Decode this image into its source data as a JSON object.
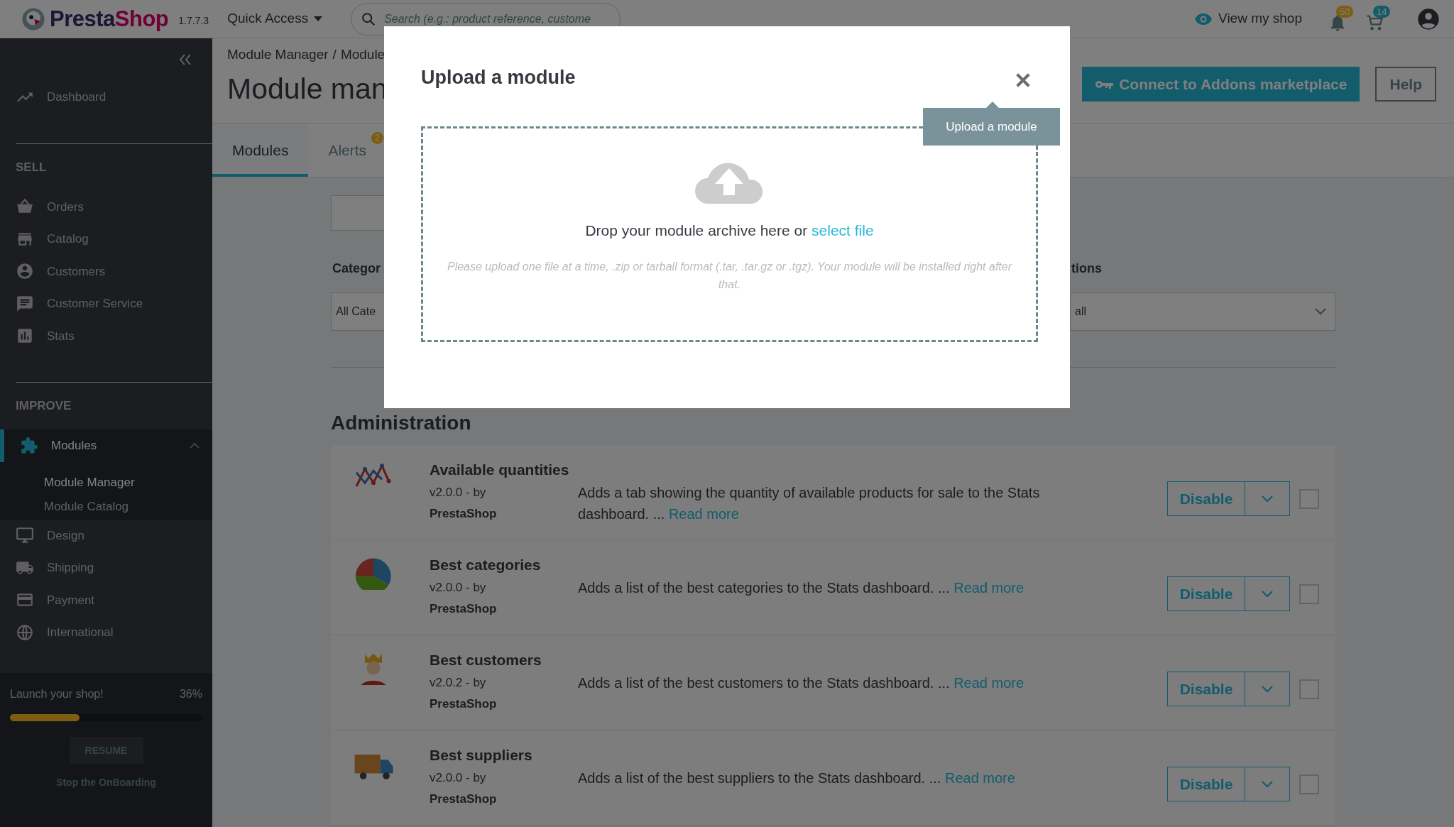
{
  "topbar": {
    "logo": {
      "first": "Presta",
      "second": "Shop"
    },
    "version": "1.7.7.3",
    "quick_access": "Quick Access",
    "search": {
      "placeholder": "Search (e.g.: product reference, custome"
    },
    "view_shop": "View my shop",
    "notifications_count": "50",
    "orders_count": "14"
  },
  "sidebar": {
    "top_items": [
      {
        "label": "Dashboard",
        "kind": "trend",
        "selected": false
      }
    ],
    "sections": [
      {
        "title": "SELL",
        "items": [
          {
            "label": "Orders",
            "kind": "basket",
            "selected": false
          },
          {
            "label": "Catalog",
            "kind": "store",
            "selected": false
          },
          {
            "label": "Customers",
            "kind": "person",
            "selected": false
          },
          {
            "label": "Customer Service",
            "kind": "chat",
            "selected": false
          },
          {
            "label": "Stats",
            "kind": "stats",
            "selected": false
          }
        ]
      },
      {
        "title": "IMPROVE",
        "items": [
          {
            "label": "Modules",
            "kind": "puzzle",
            "selected": true,
            "expanded": true,
            "children": [
              {
                "label": "Module Manager",
                "selected": true
              },
              {
                "label": "Module Catalog",
                "selected": false
              }
            ]
          },
          {
            "label": "Design",
            "kind": "monitor",
            "selected": false
          },
          {
            "label": "Shipping",
            "kind": "truck",
            "selected": false
          },
          {
            "label": "Payment",
            "kind": "card",
            "selected": false
          },
          {
            "label": "International",
            "kind": "globe",
            "selected": false
          }
        ]
      }
    ],
    "onboarding": {
      "title": "Launch your shop!",
      "percent": "36%",
      "level": 0.36,
      "button": "RESUME",
      "link": "Stop the OnBoarding"
    }
  },
  "header": {
    "breadcrumb": [
      "Module Manager",
      "Module"
    ],
    "breadcrumb_separator": "/",
    "title": "Module man",
    "buttons": [
      {
        "label": "Connect to Addons marketplace",
        "kind": "primary"
      },
      {
        "label": "Help",
        "kind": "outline"
      }
    ]
  },
  "tabs": [
    {
      "label": "Modules",
      "selected": true
    },
    {
      "label": "Alerts",
      "selected": false,
      "badge": "2"
    }
  ],
  "filters": {
    "category": {
      "label": "Categor",
      "value": "All Cate"
    },
    "status": {
      "label": "tions",
      "value": "all"
    }
  },
  "section_title": "Administration",
  "modules": [
    {
      "kind": "chart",
      "name": "Available quantities",
      "version": "v2.0.0 - by",
      "author": "PrestaShop",
      "description": "Adds a tab showing the quantity of available products for sale to the Stats dashboard. ...",
      "link": "Read more",
      "action": "Disable",
      "checked": false
    },
    {
      "kind": "pie",
      "name": "Best categories",
      "version": "v2.0.0 - by",
      "author": "PrestaShop",
      "description": "Adds a list of the best categories to the Stats dashboard. ...",
      "link": "Read more",
      "action": "Disable",
      "checked": false
    },
    {
      "kind": "person",
      "name": "Best customers",
      "version": "v2.0.2 - by",
      "author": "PrestaShop",
      "description": "Adds a list of the best customers to the Stats dashboard. ...",
      "link": "Read more",
      "action": "Disable",
      "checked": false
    },
    {
      "kind": "truck",
      "name": "Best suppliers",
      "version": "v2.0.0 - by",
      "author": "PrestaShop",
      "description": "Adds a list of the best suppliers to the Stats dashboard. ...",
      "link": "Read more",
      "action": "Disable",
      "checked": false
    }
  ],
  "modal": {
    "title": "Upload a module",
    "tooltip": "Upload a module",
    "drop_text": "Drop your module archive here or",
    "link": "select file",
    "hint": "Please upload one file at a time, .zip or tarball format (.tar, .tar.gz or .tgz). Your module will be installed right after that."
  }
}
